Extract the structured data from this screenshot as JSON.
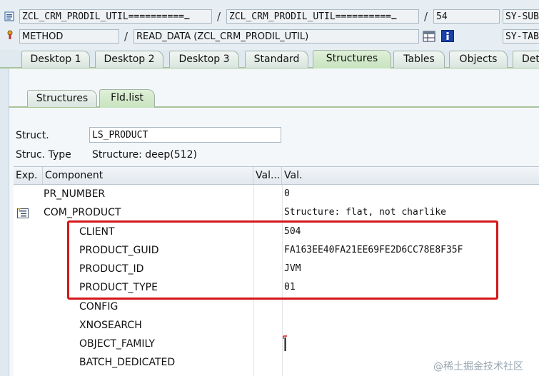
{
  "header": {
    "row1": {
      "program_field": "ZCL_CRM_PRODIL_UTIL==========…",
      "include_field": "ZCL_CRM_PRODIL_UTIL==========…",
      "line_field": "54",
      "sysfield": "SY-SUB"
    },
    "row2": {
      "event_type": "METHOD",
      "event_name": "READ_DATA (ZCL_CRM_PRODIL_UTIL)",
      "sysfield": "SY-TAB"
    },
    "separator": "/"
  },
  "main_tabs": [
    {
      "label": "Desktop 1"
    },
    {
      "label": "Desktop 2"
    },
    {
      "label": "Desktop 3"
    },
    {
      "label": "Standard"
    },
    {
      "label": "Structures"
    },
    {
      "label": "Tables"
    },
    {
      "label": "Objects"
    },
    {
      "label": "Det"
    }
  ],
  "sub_tabs": [
    {
      "label": "Structures"
    },
    {
      "label": "Fld.list"
    }
  ],
  "struct": {
    "label": "Struct.",
    "value": "LS_PRODUCT",
    "type_label": "Struc. Type",
    "type_value": "Structure: deep(512)"
  },
  "table": {
    "columns": [
      "Exp.",
      "Component",
      "Val...",
      "Val."
    ],
    "rows": [
      {
        "component": "PR_NUMBER",
        "value": "0"
      },
      {
        "component": "COM_PRODUCT",
        "value": "Structure: flat, not charlike"
      },
      {
        "component": "CLIENT",
        "value": "504"
      },
      {
        "component": "PRODUCT_GUID",
        "value": "FA163EE40FA21EE69FE2D6CC78E8F35F"
      },
      {
        "component": "PRODUCT_ID",
        "value": "JVM"
      },
      {
        "component": "PRODUCT_TYPE",
        "value": "01"
      },
      {
        "component": "CONFIG",
        "value": ""
      },
      {
        "component": "XNOSEARCH",
        "value": ""
      },
      {
        "component": "OBJECT_FAMILY",
        "value": ""
      },
      {
        "component": "BATCH_DEDICATED",
        "value": ""
      }
    ]
  },
  "watermark": "@稀土掘金技术社区",
  "colors": {
    "highlight_box": "#d3171b",
    "active_tab": "#c8e3bf"
  }
}
